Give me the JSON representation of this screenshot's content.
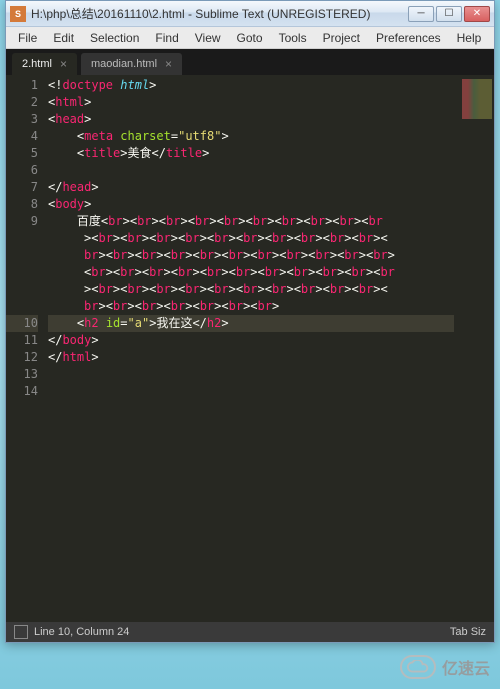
{
  "titlebar": {
    "title": "H:\\php\\总结\\20161110\\2.html - Sublime Text (UNREGISTERED)"
  },
  "menubar": {
    "items": [
      "File",
      "Edit",
      "Selection",
      "Find",
      "View",
      "Goto",
      "Tools",
      "Project",
      "Preferences",
      "Help"
    ]
  },
  "tabs": [
    {
      "label": "2.html",
      "active": true
    },
    {
      "label": "maodian.html",
      "active": false
    }
  ],
  "gutter": {
    "lines": [
      "1",
      "2",
      "3",
      "4",
      "5",
      "6",
      "7",
      "8",
      "9",
      "",
      "",
      "",
      "",
      "",
      "10",
      "11",
      "12",
      "13",
      "14"
    ],
    "current_index": 14
  },
  "code": {
    "doctype_open": "<!",
    "doctype_kw": "doctype",
    "doctype_sp": " ",
    "doctype_val": "html",
    "doctype_close": ">",
    "lt": "<",
    "lts": "</",
    "gt": ">",
    "html": "html",
    "head": "head",
    "meta": "meta",
    "title": "title",
    "body": "body",
    "br": "br",
    "h2": "h2",
    "charset_attr": "charset",
    "charset_eq": "=",
    "charset_val": "\"utf8\"",
    "id_attr": "id",
    "id_eq": "=",
    "id_val": "\"a\"",
    "title_text": "美食",
    "baidu_text": "百度",
    "h2_text": "我在这",
    "sl": "/"
  },
  "statusbar": {
    "position": "Line 10, Column 24",
    "right": "Tab Siz"
  },
  "watermark": {
    "text": "亿速云"
  }
}
